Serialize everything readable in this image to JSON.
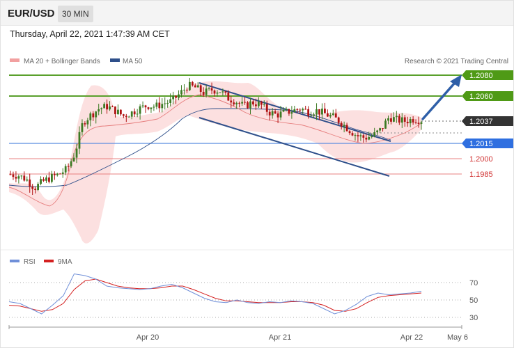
{
  "header": {
    "symbol": "EUR/USD",
    "timeframe": "30 MIN",
    "datetime": "Thursday, April 22, 2021 1:47:39 AM CET"
  },
  "legend": {
    "ma20_label": "MA 20 + Bollinger Bands",
    "ma50_label": "MA 50",
    "credit": "Research © 2021 Trading Central"
  },
  "colors": {
    "up_candle": "#3c7a23",
    "down_candle": "#b01313",
    "green_level": "#5aa02c",
    "blue_level": "#2f6fe0",
    "red_level": "#e06060",
    "ma20": "#e67d7d",
    "ma50": "#2e4f8a",
    "bollinger_fill": "#fbd9d9",
    "channel": "#2e4f8a",
    "current_price_tag": "#333333",
    "rsi": "#6f8fd8",
    "rsi_ma": "#d42020"
  },
  "price_levels": [
    {
      "value": "1.2080",
      "kind": "resistance",
      "style": "green"
    },
    {
      "value": "1.2060",
      "kind": "resistance",
      "style": "green"
    },
    {
      "value": "1.2037",
      "kind": "current",
      "style": "dark"
    },
    {
      "value": "1.2015",
      "kind": "pivot",
      "style": "blue"
    },
    {
      "value": "1.2000",
      "kind": "support",
      "style": "red"
    },
    {
      "value": "1.1985",
      "kind": "support",
      "style": "red"
    }
  ],
  "rsi_panel": {
    "rsi_label": "RSI",
    "ma_label": "9MA",
    "levels": [
      "70",
      "50",
      "30"
    ]
  },
  "x_axis": {
    "labels": [
      "Apr 20",
      "Apr 21",
      "Apr 22",
      "May 6"
    ]
  },
  "chart_data": {
    "type": "candlestick",
    "symbol": "EUR/USD",
    "interval": "30 MIN",
    "ylim": [
      1.196,
      1.209
    ],
    "price_series_approx": [
      1.1985,
      1.1984,
      1.198,
      1.1972,
      1.1978,
      1.1982,
      1.1985,
      1.199,
      1.2005,
      1.2035,
      1.2042,
      1.2048,
      1.205,
      1.2046,
      1.2041,
      1.2044,
      1.2048,
      1.2051,
      1.205,
      1.2053,
      1.2055,
      1.2062,
      1.207,
      1.2068,
      1.2063,
      1.2066,
      1.2065,
      1.2058,
      1.2055,
      1.205,
      1.2054,
      1.2052,
      1.2045,
      1.2042,
      1.2044,
      1.2046,
      1.2048,
      1.2045,
      1.2046,
      1.2043,
      1.204,
      1.2035,
      1.2028,
      1.2022,
      1.202,
      1.2022,
      1.2028,
      1.204,
      1.2037,
      1.2036,
      1.2038,
      1.2037
    ],
    "rsi_series_approx": [
      48,
      46,
      40,
      34,
      44,
      55,
      80,
      78,
      74,
      66,
      64,
      63,
      62,
      63,
      66,
      68,
      64,
      58,
      52,
      48,
      47,
      50,
      47,
      46,
      48,
      47,
      49,
      48,
      46,
      40,
      34,
      38,
      45,
      54,
      58,
      56,
      57,
      58,
      60
    ],
    "rsi_ma_series_approx": [
      44,
      43,
      40,
      37,
      39,
      46,
      62,
      72,
      74,
      70,
      66,
      64,
      63,
      63,
      64,
      66,
      66,
      62,
      57,
      52,
      49,
      49,
      48,
      47,
      47,
      47,
      48,
      48,
      47,
      44,
      38,
      37,
      40,
      47,
      53,
      55,
      56,
      57,
      58
    ],
    "rsi_ylim": [
      20,
      80
    ],
    "x_labels": [
      "Apr 20",
      "Apr 21",
      "Apr 22",
      "May 6"
    ],
    "annotations": [
      "descending channel",
      "breakout arrow toward 1.2080"
    ]
  }
}
